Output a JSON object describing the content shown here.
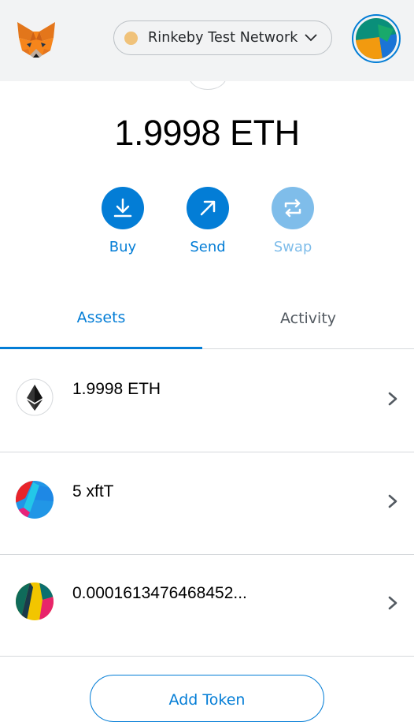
{
  "header": {
    "network": {
      "name": "Rinkeby Test Network",
      "dot_color": "#f0c27a"
    }
  },
  "balance": {
    "text": "1.9998 ETH"
  },
  "actions": [
    {
      "label": "Buy",
      "icon": "download-icon",
      "enabled": true
    },
    {
      "label": "Send",
      "icon": "arrow-up-right-icon",
      "enabled": true
    },
    {
      "label": "Swap",
      "icon": "swap-icon",
      "enabled": false
    }
  ],
  "tabs": [
    {
      "label": "Assets",
      "active": true
    },
    {
      "label": "Activity",
      "active": false
    }
  ],
  "assets": [
    {
      "label": "1.9998 ETH",
      "icon": "ethereum-icon"
    },
    {
      "label": "5 xftT",
      "icon": "token-identicon"
    },
    {
      "label": "0.0001613476468452...",
      "icon": "token-identicon"
    }
  ],
  "add_token_label": "Add Token",
  "colors": {
    "accent": "#037dd6",
    "accent_disabled": "#7fbdea",
    "header_bg": "#f2f3f4"
  }
}
